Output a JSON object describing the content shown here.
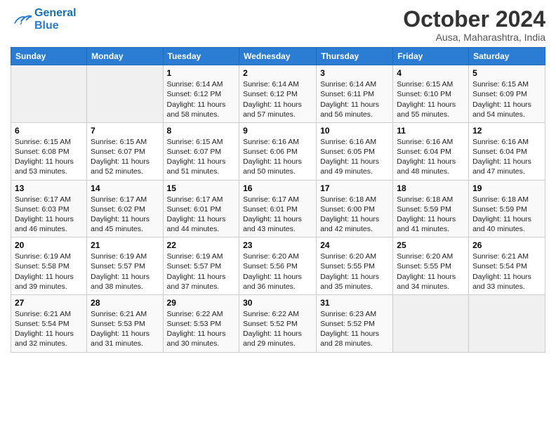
{
  "header": {
    "logo_line1": "General",
    "logo_line2": "Blue",
    "month": "October 2024",
    "location": "Ausa, Maharashtra, India"
  },
  "weekdays": [
    "Sunday",
    "Monday",
    "Tuesday",
    "Wednesday",
    "Thursday",
    "Friday",
    "Saturday"
  ],
  "weeks": [
    [
      {
        "day": "",
        "info": ""
      },
      {
        "day": "",
        "info": ""
      },
      {
        "day": "1",
        "info": "Sunrise: 6:14 AM\nSunset: 6:12 PM\nDaylight: 11 hours and 58 minutes."
      },
      {
        "day": "2",
        "info": "Sunrise: 6:14 AM\nSunset: 6:12 PM\nDaylight: 11 hours and 57 minutes."
      },
      {
        "day": "3",
        "info": "Sunrise: 6:14 AM\nSunset: 6:11 PM\nDaylight: 11 hours and 56 minutes."
      },
      {
        "day": "4",
        "info": "Sunrise: 6:15 AM\nSunset: 6:10 PM\nDaylight: 11 hours and 55 minutes."
      },
      {
        "day": "5",
        "info": "Sunrise: 6:15 AM\nSunset: 6:09 PM\nDaylight: 11 hours and 54 minutes."
      }
    ],
    [
      {
        "day": "6",
        "info": "Sunrise: 6:15 AM\nSunset: 6:08 PM\nDaylight: 11 hours and 53 minutes."
      },
      {
        "day": "7",
        "info": "Sunrise: 6:15 AM\nSunset: 6:07 PM\nDaylight: 11 hours and 52 minutes."
      },
      {
        "day": "8",
        "info": "Sunrise: 6:15 AM\nSunset: 6:07 PM\nDaylight: 11 hours and 51 minutes."
      },
      {
        "day": "9",
        "info": "Sunrise: 6:16 AM\nSunset: 6:06 PM\nDaylight: 11 hours and 50 minutes."
      },
      {
        "day": "10",
        "info": "Sunrise: 6:16 AM\nSunset: 6:05 PM\nDaylight: 11 hours and 49 minutes."
      },
      {
        "day": "11",
        "info": "Sunrise: 6:16 AM\nSunset: 6:04 PM\nDaylight: 11 hours and 48 minutes."
      },
      {
        "day": "12",
        "info": "Sunrise: 6:16 AM\nSunset: 6:04 PM\nDaylight: 11 hours and 47 minutes."
      }
    ],
    [
      {
        "day": "13",
        "info": "Sunrise: 6:17 AM\nSunset: 6:03 PM\nDaylight: 11 hours and 46 minutes."
      },
      {
        "day": "14",
        "info": "Sunrise: 6:17 AM\nSunset: 6:02 PM\nDaylight: 11 hours and 45 minutes."
      },
      {
        "day": "15",
        "info": "Sunrise: 6:17 AM\nSunset: 6:01 PM\nDaylight: 11 hours and 44 minutes."
      },
      {
        "day": "16",
        "info": "Sunrise: 6:17 AM\nSunset: 6:01 PM\nDaylight: 11 hours and 43 minutes."
      },
      {
        "day": "17",
        "info": "Sunrise: 6:18 AM\nSunset: 6:00 PM\nDaylight: 11 hours and 42 minutes."
      },
      {
        "day": "18",
        "info": "Sunrise: 6:18 AM\nSunset: 5:59 PM\nDaylight: 11 hours and 41 minutes."
      },
      {
        "day": "19",
        "info": "Sunrise: 6:18 AM\nSunset: 5:59 PM\nDaylight: 11 hours and 40 minutes."
      }
    ],
    [
      {
        "day": "20",
        "info": "Sunrise: 6:19 AM\nSunset: 5:58 PM\nDaylight: 11 hours and 39 minutes."
      },
      {
        "day": "21",
        "info": "Sunrise: 6:19 AM\nSunset: 5:57 PM\nDaylight: 11 hours and 38 minutes."
      },
      {
        "day": "22",
        "info": "Sunrise: 6:19 AM\nSunset: 5:57 PM\nDaylight: 11 hours and 37 minutes."
      },
      {
        "day": "23",
        "info": "Sunrise: 6:20 AM\nSunset: 5:56 PM\nDaylight: 11 hours and 36 minutes."
      },
      {
        "day": "24",
        "info": "Sunrise: 6:20 AM\nSunset: 5:55 PM\nDaylight: 11 hours and 35 minutes."
      },
      {
        "day": "25",
        "info": "Sunrise: 6:20 AM\nSunset: 5:55 PM\nDaylight: 11 hours and 34 minutes."
      },
      {
        "day": "26",
        "info": "Sunrise: 6:21 AM\nSunset: 5:54 PM\nDaylight: 11 hours and 33 minutes."
      }
    ],
    [
      {
        "day": "27",
        "info": "Sunrise: 6:21 AM\nSunset: 5:54 PM\nDaylight: 11 hours and 32 minutes."
      },
      {
        "day": "28",
        "info": "Sunrise: 6:21 AM\nSunset: 5:53 PM\nDaylight: 11 hours and 31 minutes."
      },
      {
        "day": "29",
        "info": "Sunrise: 6:22 AM\nSunset: 5:53 PM\nDaylight: 11 hours and 30 minutes."
      },
      {
        "day": "30",
        "info": "Sunrise: 6:22 AM\nSunset: 5:52 PM\nDaylight: 11 hours and 29 minutes."
      },
      {
        "day": "31",
        "info": "Sunrise: 6:23 AM\nSunset: 5:52 PM\nDaylight: 11 hours and 28 minutes."
      },
      {
        "day": "",
        "info": ""
      },
      {
        "day": "",
        "info": ""
      }
    ]
  ]
}
